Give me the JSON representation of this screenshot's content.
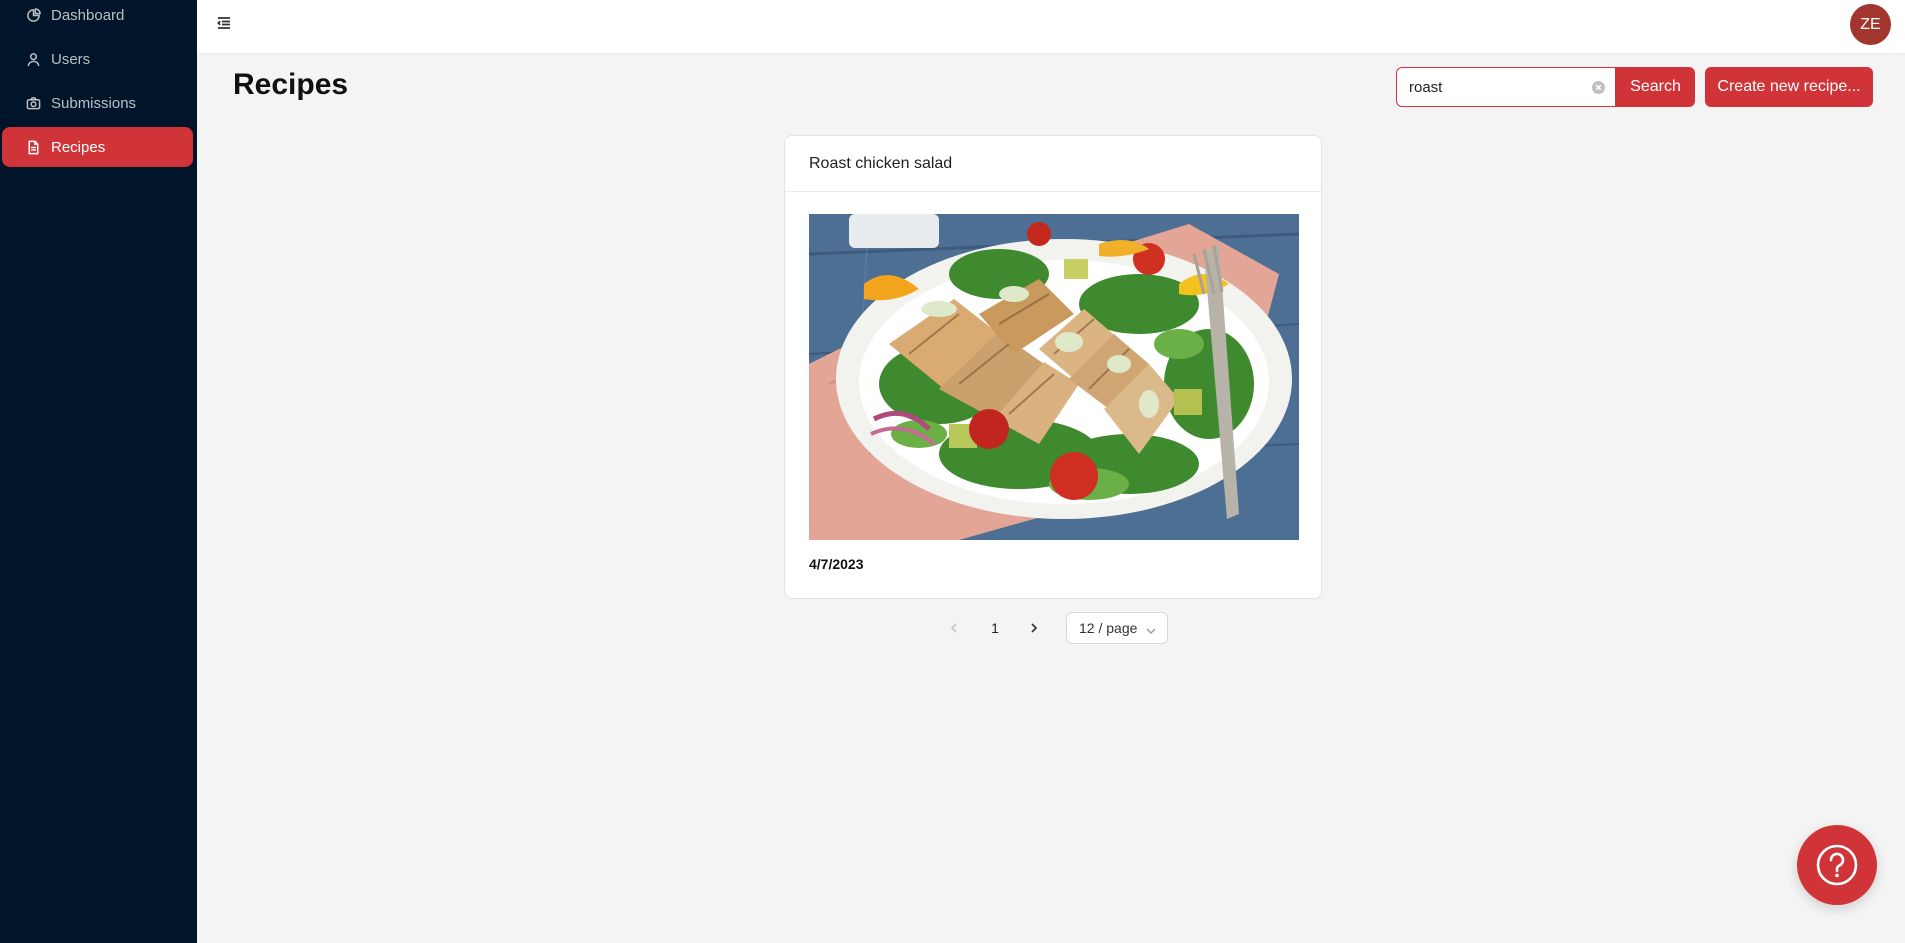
{
  "sidebar": {
    "items": [
      {
        "label": "Dashboard",
        "icon": "pie-chart-icon"
      },
      {
        "label": "Users",
        "icon": "user-icon"
      },
      {
        "label": "Submissions",
        "icon": "camera-icon"
      },
      {
        "label": "Recipes",
        "icon": "file-icon",
        "active": true
      }
    ]
  },
  "header": {
    "avatar_initials": "ZE"
  },
  "page": {
    "title": "Recipes"
  },
  "search": {
    "value": "roast",
    "button_label": "Search"
  },
  "create_button_label": "Create new recipe...",
  "recipes": [
    {
      "title": "Roast chicken salad",
      "date": "4/7/2023"
    }
  ],
  "pagination": {
    "current_page": "1",
    "page_size_label": "12 / page"
  },
  "colors": {
    "accent": "#d13438",
    "sidebar_bg": "#001529",
    "avatar_bg": "#a3352f"
  }
}
